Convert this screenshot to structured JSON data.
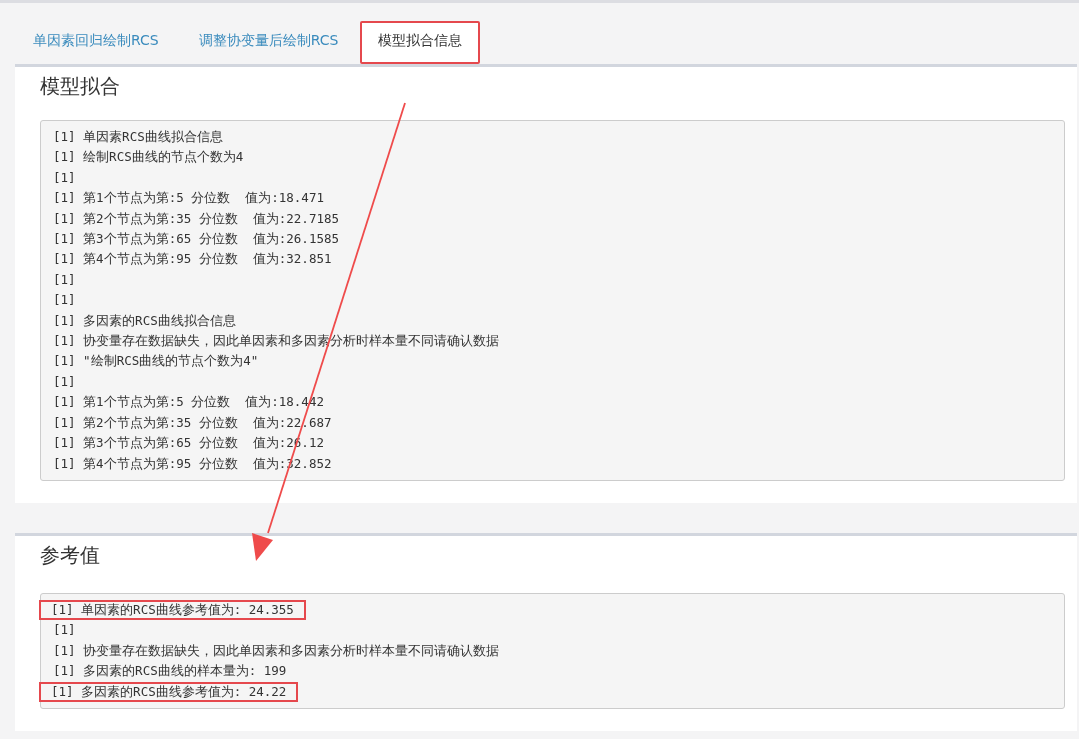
{
  "tabs": [
    {
      "label": "单因素回归绘制RCS",
      "selected": false,
      "highlighted": false
    },
    {
      "label": "调整协变量后绘制RCS",
      "selected": false,
      "highlighted": false
    },
    {
      "label": "模型拟合信息",
      "selected": true,
      "highlighted": true
    }
  ],
  "panels": [
    {
      "title": "模型拟合",
      "lines": [
        {
          "text": "[1] 单因素RCS曲线拟合信息",
          "highlighted": false
        },
        {
          "text": "[1] 绘制RCS曲线的节点个数为4",
          "highlighted": false
        },
        {
          "text": "[1]",
          "highlighted": false
        },
        {
          "text": "[1] 第1个节点为第:5 分位数  值为:18.471",
          "highlighted": false
        },
        {
          "text": "[1] 第2个节点为第:35 分位数  值为:22.7185",
          "highlighted": false
        },
        {
          "text": "[1] 第3个节点为第:65 分位数  值为:26.1585",
          "highlighted": false
        },
        {
          "text": "[1] 第4个节点为第:95 分位数  值为:32.851",
          "highlighted": false
        },
        {
          "text": "[1]",
          "highlighted": false
        },
        {
          "text": "[1]",
          "highlighted": false
        },
        {
          "text": "[1] 多因素的RCS曲线拟合信息",
          "highlighted": false
        },
        {
          "text": "[1] 协变量存在数据缺失，因此单因素和多因素分析时样本量不同请确认数据",
          "highlighted": false
        },
        {
          "text": "[1] \"绘制RCS曲线的节点个数为4\"",
          "highlighted": false
        },
        {
          "text": "[1]",
          "highlighted": false
        },
        {
          "text": "[1] 第1个节点为第:5 分位数  值为:18.442",
          "highlighted": false
        },
        {
          "text": "[1] 第2个节点为第:35 分位数  值为:22.687",
          "highlighted": false
        },
        {
          "text": "[1] 第3个节点为第:65 分位数  值为:26.12",
          "highlighted": false
        },
        {
          "text": "[1] 第4个节点为第:95 分位数  值为:32.852",
          "highlighted": false
        }
      ]
    },
    {
      "title": "参考值",
      "lines": [
        {
          "text": "[1] 单因素的RCS曲线参考值为: 24.355",
          "highlighted": true
        },
        {
          "text": "[1]",
          "highlighted": false
        },
        {
          "text": "[1] 协变量存在数据缺失，因此单因素和多因素分析时样本量不同请确认数据",
          "highlighted": false
        },
        {
          "text": "[1] 多因素的RCS曲线的样本量为: 199",
          "highlighted": false
        },
        {
          "text": "[1] 多因素的RCS曲线参考值为: 24.22",
          "highlighted": true
        }
      ]
    }
  ]
}
